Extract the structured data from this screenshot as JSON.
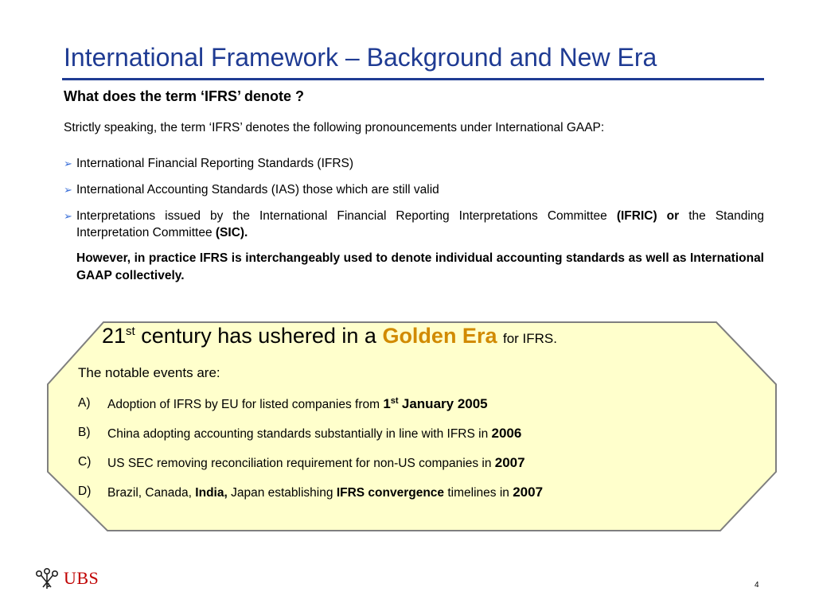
{
  "slide": {
    "title": "International Framework – Background and New Era",
    "subheading": "What does the term ‘IFRS’ denote ?",
    "intro": "Strictly speaking, the term ‘IFRS’ denotes the following pronouncements under International GAAP:",
    "bullets": [
      {
        "text": "International Financial Reporting Standards (IFRS)"
      },
      {
        "text": "International Accounting Standards (IAS) those which are still valid"
      },
      {
        "text_a": "Interpretations issued by the International Financial Reporting Interpretations Committee",
        "bold_a": "(IFRIC) or",
        "text_b": "the Standing Interpretation Committee",
        "bold_b": "(SIC)."
      }
    ],
    "note": "However, in practice IFRS is interchangeably used to denote individual accounting standards as well as International GAAP collectively.",
    "bullet_symbol": "➢",
    "page_number": "4"
  },
  "golden_era": {
    "headline_num": "21",
    "headline_sup": "st",
    "headline_mid": "century has ushered in a",
    "headline_highlight": "Golden Era",
    "headline_tail": "for IFRS.",
    "events_intro": "The notable events are:",
    "events": [
      {
        "marker": "A)",
        "text": "Adoption of IFRS by EU for listed companies from",
        "bold_num": "1",
        "bold_sup": "st",
        "bold_tail": "January 2005"
      },
      {
        "marker": "B)",
        "text": "China adopting accounting standards substantially in line with IFRS in",
        "bold": "2006"
      },
      {
        "marker": "C)",
        "text": "US SEC removing reconciliation requirement for non-US companies in",
        "bold": "2007"
      },
      {
        "marker": "D)",
        "text_a": "Brazil, Canada,",
        "bold_a": "India,",
        "text_b": "Japan establishing",
        "bold_b": "IFRS convergence",
        "text_c": "timelines in",
        "bold_c": "2007"
      }
    ]
  },
  "logo": {
    "text": "UBS",
    "icon": "ubs-keys-icon"
  },
  "colors": {
    "title": "#1f3b93",
    "highlight": "#d18a00",
    "panel_fill": "#ffffcc",
    "panel_border": "#7f7f7f",
    "logo": "#c00000",
    "bullet": "#3a6fd8"
  }
}
